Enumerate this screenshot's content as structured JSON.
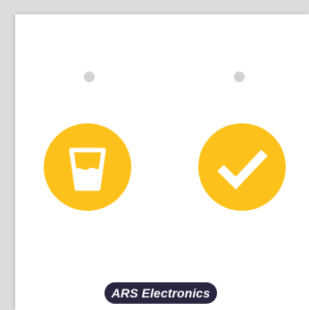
{
  "indicators": [
    {
      "state": "off",
      "color": "#d2d2d2"
    },
    {
      "state": "off",
      "color": "#d2d2d2"
    }
  ],
  "buttons": [
    {
      "icon": "water-glass-icon",
      "color": "#fcc21b"
    },
    {
      "icon": "checkmark-icon",
      "color": "#fcc21b"
    }
  ],
  "brand": {
    "label": "ARS Electronics",
    "background": "#2a2540"
  }
}
